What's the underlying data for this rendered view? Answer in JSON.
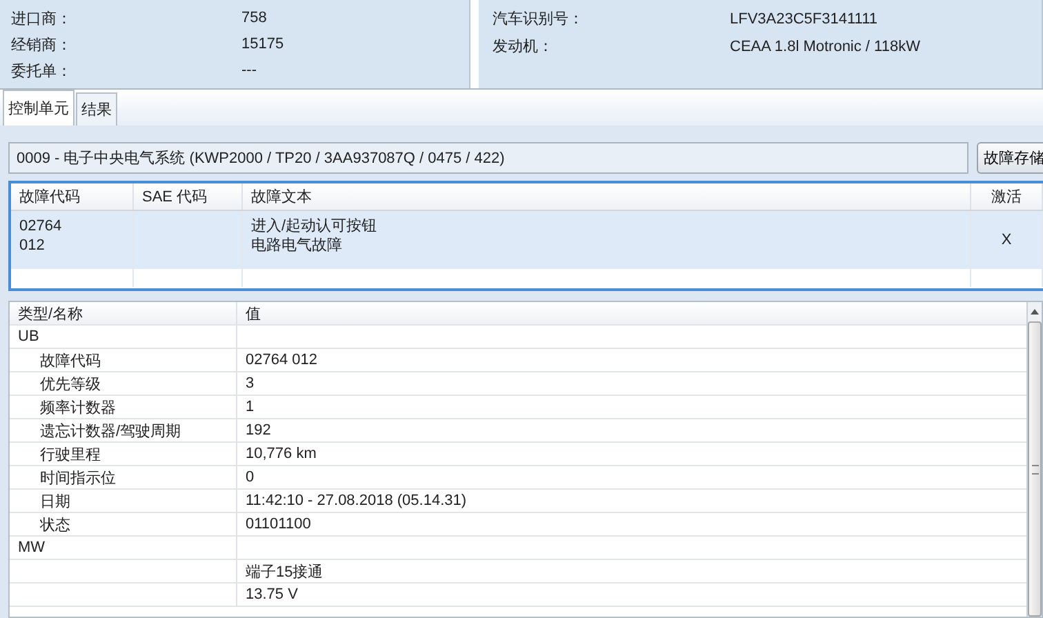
{
  "info_panels": [
    {
      "fields": [
        {
          "label": "进口商：",
          "value": "758"
        },
        {
          "label": "经销商：",
          "value": "15175"
        },
        {
          "label": "委托单：",
          "value": "---"
        }
      ]
    },
    {
      "fields": [
        {
          "label": "汽车识别号：",
          "value": "LFV3A23C5F3141111"
        },
        {
          "label": "发动机：",
          "value": "CEAA 1.8l Motronic / 118kW"
        }
      ]
    }
  ],
  "tabs": [
    {
      "label": "控制单元",
      "selected": true
    },
    {
      "label": "结果",
      "selected": false
    }
  ],
  "module_field": {
    "value": "0009 - 电子中央电气系统  (KWP2000 / TP20 / 3AA937087Q / 0475 / 422)"
  },
  "fault_memory_button": "故障存储",
  "fault_table": {
    "columns": [
      "故障代码",
      "SAE 代码",
      "故障文本",
      "激活"
    ],
    "rows": [
      {
        "code": [
          "02764",
          "012"
        ],
        "text": [
          "进入/起动认可按钮",
          "电路电气故障"
        ],
        "active": "X",
        "selected": true
      }
    ]
  },
  "detail_table": {
    "columns": [
      "类型/名称",
      "值"
    ],
    "rows": [
      {
        "name": "UB",
        "children": [
          {
            "name": "故障代码",
            "value": "02764 012"
          },
          {
            "name": "优先等级",
            "value": "3"
          },
          {
            "name": "频率计数器",
            "value": "1"
          },
          {
            "name": "遗忘计数器/驾驶周期",
            "value": "192"
          },
          {
            "name": "行驶里程",
            "value": "10,776 km"
          },
          {
            "name": "时间指示位",
            "value": "0"
          },
          {
            "name": "日期",
            "value": "11:42:10 - 27.08.2018  (05.14.31)"
          },
          {
            "name": "状态",
            "value": "01101100"
          }
        ]
      },
      {
        "name": "MW",
        "children": [
          {
            "value": "端子15接通"
          },
          {
            "value": "13.75 V"
          }
        ]
      }
    ]
  }
}
